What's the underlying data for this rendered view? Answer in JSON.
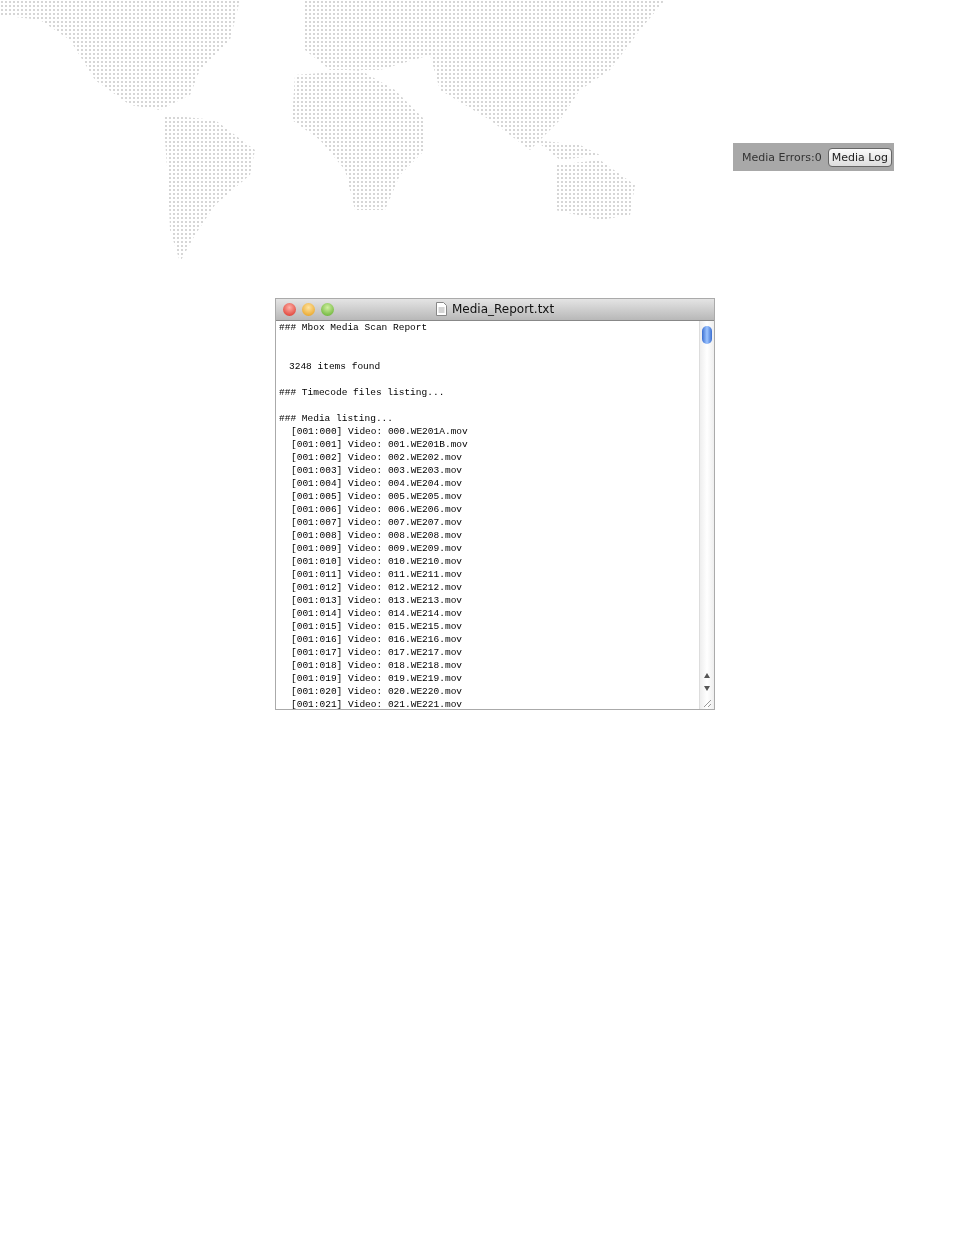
{
  "status_bar": {
    "label": "Media Errors:0",
    "button": "Media Log"
  },
  "window": {
    "title": "Media_Report.txt"
  },
  "report": {
    "lines": [
      {
        "kind": "heading",
        "text": "### Mbox Media Scan Report"
      },
      {
        "kind": "count",
        "text": "3248 items found"
      },
      {
        "kind": "heading",
        "text": "### Timecode files listing..."
      },
      {
        "kind": "heading",
        "text": "### Media listing..."
      }
    ],
    "entries": [
      "[001:000] Video: 000.WE201A.mov",
      "[001:001] Video: 001.WE201B.mov",
      "[001:002] Video: 002.WE202.mov",
      "[001:003] Video: 003.WE203.mov",
      "[001:004] Video: 004.WE204.mov",
      "[001:005] Video: 005.WE205.mov",
      "[001:006] Video: 006.WE206.mov",
      "[001:007] Video: 007.WE207.mov",
      "[001:008] Video: 008.WE208.mov",
      "[001:009] Video: 009.WE209.mov",
      "[001:010] Video: 010.WE210.mov",
      "[001:011] Video: 011.WE211.mov",
      "[001:012] Video: 012.WE212.mov",
      "[001:013] Video: 013.WE213.mov",
      "[001:014] Video: 014.WE214.mov",
      "[001:015] Video: 015.WE215.mov",
      "[001:016] Video: 016.WE216.mov",
      "[001:017] Video: 017.WE217.mov",
      "[001:018] Video: 018.WE218.mov",
      "[001:019] Video: 019.WE219.mov",
      "[001:020] Video: 020.WE220.mov",
      "[001:021] Video: 021.WE221.mov"
    ]
  }
}
